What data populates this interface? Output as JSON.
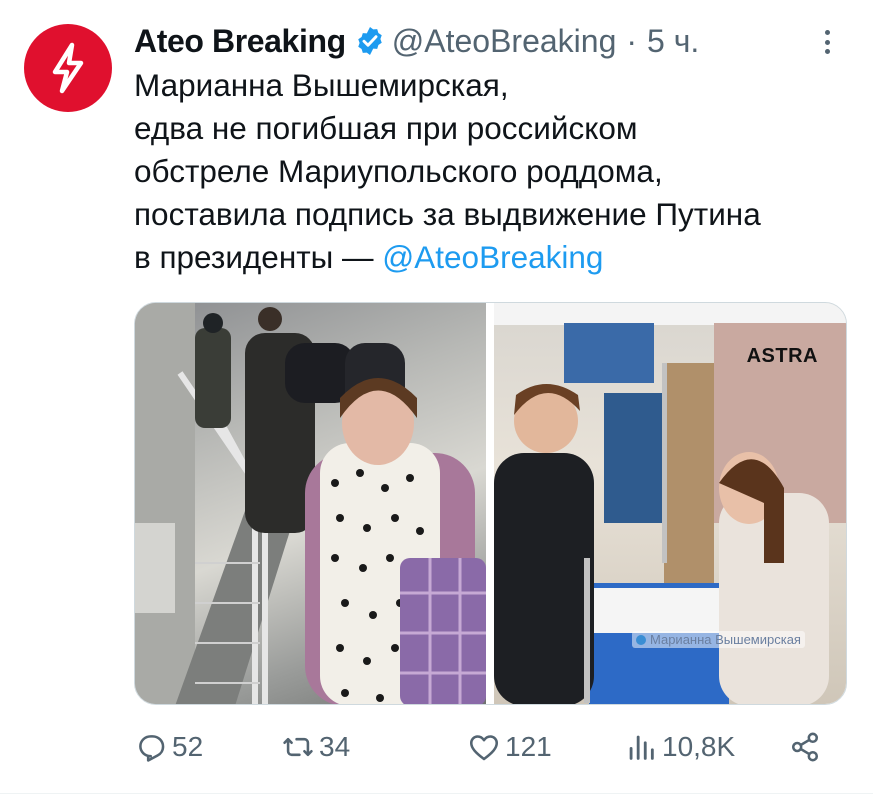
{
  "tweet": {
    "author_name": "Ateo Breaking",
    "handle": "@AteoBreaking",
    "separator": "·",
    "time": "5 ч.",
    "text_lines": [
      "Марианна Вышемирская,",
      "едва не погибшая при российском",
      "обстреле Мариупольского роддома,",
      "поставила подпись за выдвижение Путина"
    ],
    "last_line_text": "в президенты  — ",
    "mention": "@AteoBreaking"
  },
  "media": {
    "right_photo_label": "ASTRA",
    "right_photo_watermark": "Марианна Вышемирская"
  },
  "actions": {
    "replies": "52",
    "retweets": "34",
    "likes": "121",
    "views": "10,8K"
  },
  "icons": {
    "avatar": "lightning-bolt-icon",
    "verified": "verified-badge-icon",
    "more": "more-dots-icon",
    "reply": "reply-icon",
    "retweet": "retweet-icon",
    "like": "heart-icon",
    "views": "views-chart-icon",
    "share": "share-icon"
  },
  "colors": {
    "brand_red": "#e0102e",
    "link_blue": "#1d9bf0",
    "verified_blue": "#1d9bf0",
    "secondary_text": "#536471"
  }
}
